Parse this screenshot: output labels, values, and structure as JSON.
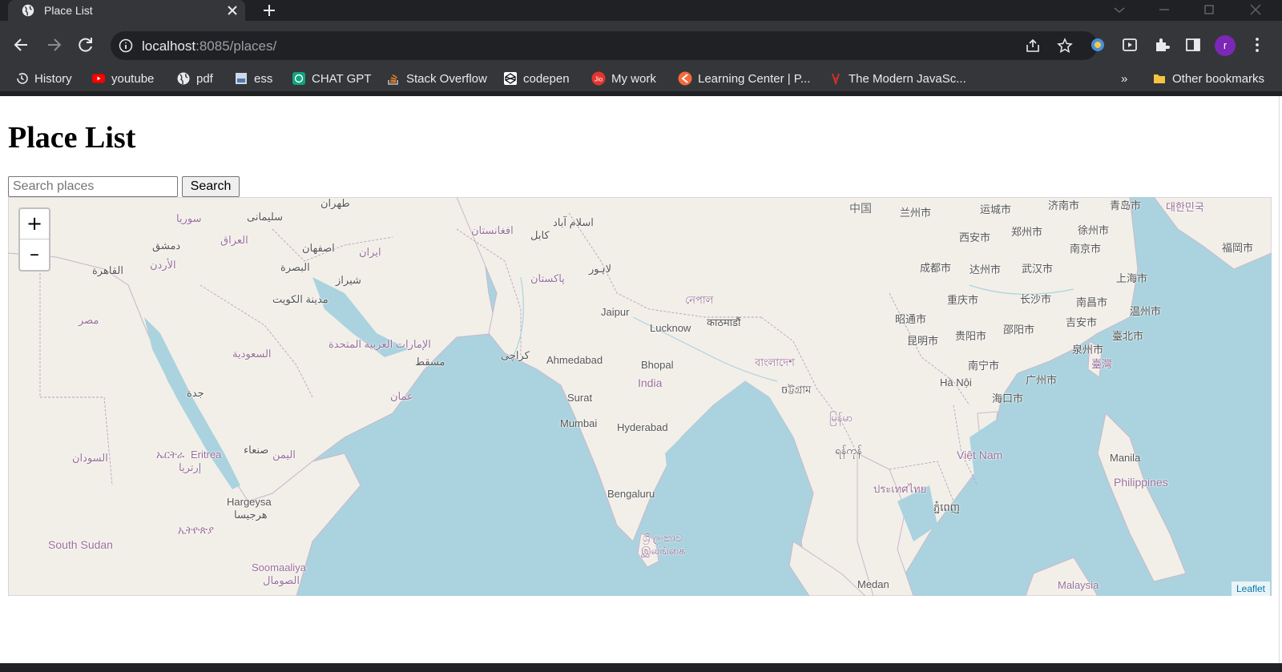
{
  "browser": {
    "tab_title": "Place List",
    "url_host": "localhost",
    "url_path": ":8085/places/",
    "avatar_letter": "r",
    "bookmarks": [
      {
        "label": "History",
        "icon": "history-icon"
      },
      {
        "label": "youtube",
        "icon": "youtube-icon"
      },
      {
        "label": "pdf",
        "icon": "globe-icon"
      },
      {
        "label": "ess",
        "icon": "page-icon"
      },
      {
        "label": "CHAT GPT",
        "icon": "chatgpt-icon"
      },
      {
        "label": "Stack Overflow",
        "icon": "stackoverflow-icon"
      },
      {
        "label": "codepen",
        "icon": "codepen-icon"
      },
      {
        "label": "My work",
        "icon": "jio-icon"
      },
      {
        "label": "Learning Center | P...",
        "icon": "learning-icon"
      },
      {
        "label": "The Modern JavaSc...",
        "icon": "js-icon"
      }
    ],
    "bookmarks_overflow": "»",
    "other_bookmarks": "Other bookmarks"
  },
  "page": {
    "heading": "Place List",
    "search_placeholder": "Search places",
    "search_button": "Search"
  },
  "map": {
    "zoom_in": "+",
    "zoom_out": "–",
    "attribution": "Leaflet",
    "labels": [
      "中国",
      "兰州市",
      "运城市",
      "济南市",
      "青岛市",
      "대한민국",
      "西安市",
      "郑州市",
      "徐州市",
      "南京市",
      "福岡市",
      "成都市",
      "达州市",
      "武汉市",
      "上海市",
      "重庆市",
      "长沙市",
      "南昌市",
      "温州市",
      "昭通市",
      "邵阳市",
      "吉安市",
      "昆明市",
      "贵阳市",
      "臺北市",
      "泉州市",
      "臺灣",
      "南宁市",
      "广州市",
      "Hà Nội",
      "海口市",
      "Việt Nam",
      "Manila",
      "Philippines",
      "ประเทศไทย",
      "ភ្នំពេញ",
      "Malaysia",
      "Medan",
      "မြန်မာ",
      "ရန်ကုန်",
      "ចট্টগ্রাম",
      "বাংলাদেশ",
      "নেপাল",
      "काठमाडौं",
      "Lucknow",
      "Jaipur",
      "India",
      "Bhopal",
      "Ahmedabad",
      "Surat",
      "Mumbai",
      "Hyderabad",
      "Bengaluru",
      "ශ්‍රී ලංකාව",
      "இலங்கை",
      "كراچى",
      "پاکستان",
      "لاہور",
      "اسلام آباد",
      "كابل",
      "افغانستان",
      "ایران",
      "اصفهان",
      "شیراز",
      "مسقط",
      "عمان",
      "الإمارات العربية المتحدة",
      "مدينة الكويت",
      "البصرة",
      "العراق",
      "سوريا",
      "دمشق",
      "الأردن",
      "القاهرة",
      "مصر",
      "السعودية",
      "جدة",
      "صنعاء",
      "اليمن",
      "Eritrea",
      "ኤርትራ",
      "إرتريا",
      "السودان",
      "South Sudan",
      "Hargeysa",
      "هرجيسا",
      "ኢትዮጵያ",
      "Soomaaliya",
      "الصومال",
      "طهران",
      "سليمانى"
    ]
  }
}
